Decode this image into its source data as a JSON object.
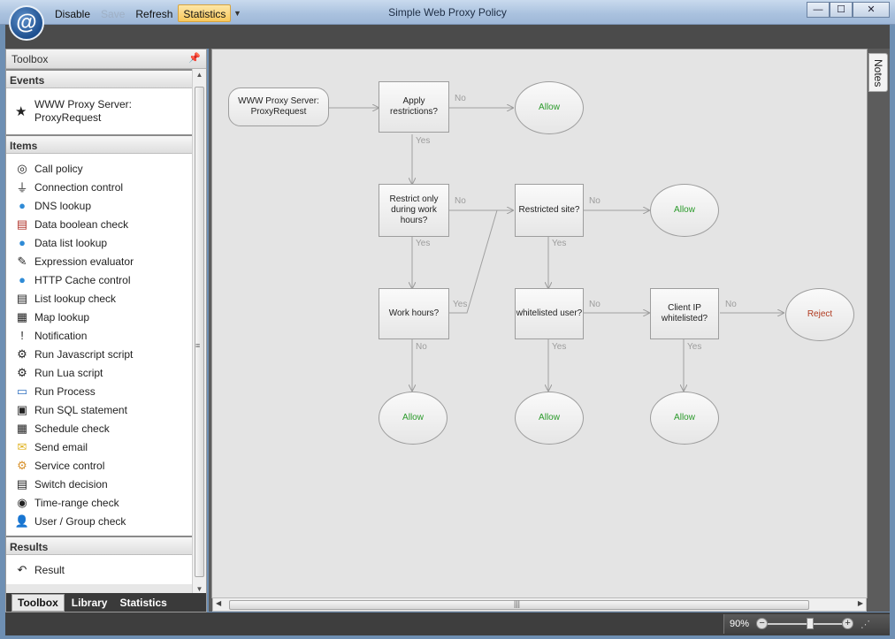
{
  "window": {
    "title": "Simple Web Proxy Policy",
    "qat": [
      {
        "label": "Disable",
        "state": "normal"
      },
      {
        "label": "Save",
        "state": "disabled"
      },
      {
        "label": "Refresh",
        "state": "normal"
      },
      {
        "label": "Statistics",
        "state": "active"
      }
    ],
    "controls": [
      "minimize-icon",
      "maximize-icon",
      "close-icon"
    ]
  },
  "toolbox": {
    "title": "Toolbox",
    "sections": {
      "events": {
        "label": "Events",
        "items": [
          {
            "label": "WWW Proxy Server: ProxyRequest",
            "icon": "star-icon"
          }
        ]
      },
      "items": {
        "label": "Items",
        "items": [
          {
            "label": "Call policy",
            "icon": "target-icon"
          },
          {
            "label": "Connection control",
            "icon": "plug-icon"
          },
          {
            "label": "DNS lookup",
            "icon": "globe-icon"
          },
          {
            "label": "Data boolean check",
            "icon": "yes-no-icon"
          },
          {
            "label": "Data list lookup",
            "icon": "globe-list-icon"
          },
          {
            "label": "Expression evaluator",
            "icon": "pencil-icon"
          },
          {
            "label": "HTTP Cache control",
            "icon": "globe-cache-icon"
          },
          {
            "label": "List lookup check",
            "icon": "list-icon"
          },
          {
            "label": "Map lookup",
            "icon": "map-icon"
          },
          {
            "label": "Notification",
            "icon": "exclamation-icon"
          },
          {
            "label": "Run Javascript script",
            "icon": "gear-icon"
          },
          {
            "label": "Run Lua script",
            "icon": "gear-icon"
          },
          {
            "label": "Run Process",
            "icon": "process-icon"
          },
          {
            "label": "Run SQL statement",
            "icon": "database-icon"
          },
          {
            "label": "Schedule check",
            "icon": "calendar-icon"
          },
          {
            "label": "Send email",
            "icon": "envelope-icon"
          },
          {
            "label": "Service control",
            "icon": "gears-icon"
          },
          {
            "label": "Switch decision",
            "icon": "switch-icon"
          },
          {
            "label": "Time-range check",
            "icon": "clock-icon"
          },
          {
            "label": "User / Group check",
            "icon": "users-icon"
          }
        ]
      },
      "results": {
        "label": "Results",
        "items": [
          {
            "label": "Result",
            "icon": "undo-arrow-icon"
          }
        ]
      }
    },
    "tabs": [
      {
        "label": "Toolbox",
        "active": true
      },
      {
        "label": "Library",
        "active": false
      },
      {
        "label": "Statistics",
        "active": false
      }
    ]
  },
  "notes": {
    "label": "Notes"
  },
  "zoom": {
    "label": "90%",
    "level": 0.55
  },
  "diagram": {
    "nodes": {
      "start": "WWW Proxy Server: ProxyRequest",
      "apply": "Apply restrictions?",
      "allow1": "Allow",
      "restrict_hours": "Restrict only during work hours?",
      "restricted_site": "Restricted site?",
      "allow2": "Allow",
      "work_hours": "Work hours?",
      "whitelisted_user": "whitelisted user?",
      "client_ip": "Client IP whitelisted?",
      "reject": "Reject",
      "allow3": "Allow",
      "allow4": "Allow",
      "allow5": "Allow"
    },
    "labels": {
      "no": "No",
      "yes": "Yes"
    }
  },
  "colors": {
    "allow": "#2a9a2a",
    "reject": "#b03a1f",
    "active_tab": "#f8c85b"
  }
}
